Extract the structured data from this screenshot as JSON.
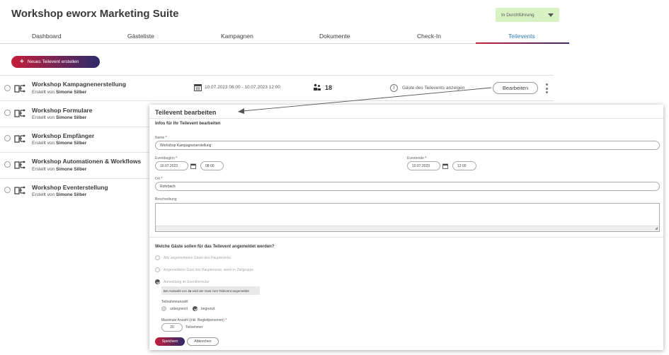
{
  "app": {
    "title": "Workshop eworx Marketing Suite"
  },
  "status_dropdown": {
    "value": "In Durchführung"
  },
  "tabs": [
    {
      "label": "Dashboard"
    },
    {
      "label": "Gästeliste"
    },
    {
      "label": "Kampagnen"
    },
    {
      "label": "Dokumente"
    },
    {
      "label": "Check-In"
    },
    {
      "label": "Teilevents"
    }
  ],
  "active_tab": "Teilevents",
  "new_button": {
    "label": "Neues Teilevent erstellen"
  },
  "events": [
    {
      "title": "Workshop Kampagnenerstellung",
      "created_prefix": "Erstellt von",
      "author": "Simone Silber"
    },
    {
      "title": "Workshop Formulare",
      "created_prefix": "Erstellt von",
      "author": "Simone Silber"
    },
    {
      "title": "Workshop Empfänger",
      "created_prefix": "Erstellt von",
      "author": "Simone Silber"
    },
    {
      "title": "Workshop Automationen & Workflows",
      "created_prefix": "Erstellt von",
      "author": "Simone Silber"
    },
    {
      "title": "Workshop Eventerstellung",
      "created_prefix": "Erstellt von",
      "author": "Simone Silber"
    }
  ],
  "first_row": {
    "date_range": "10.07.2023 08:00 - 10.07.2023 12:00",
    "guest_count": "18",
    "guests_link": "Gäste des Teilevents anzeigen",
    "info_glyph": "i",
    "edit_label": "Bearbeiten"
  },
  "modal": {
    "title": "Teilevent bearbeiten",
    "subtitle": "Infos für Ihr Teilevent bearbeiten",
    "name_label": "Name",
    "name_value": "Workshop Kampagnenerstellung",
    "start_label": "Eventbeginn",
    "start_date": "10.07.2023",
    "start_time": "08:00",
    "end_label": "Eventende",
    "end_date": "10.07.2023",
    "end_time": "12:00",
    "location_label": "Ort",
    "location_value": "Rohrbach",
    "description_label": "Beschreibung",
    "required_mark": "*",
    "question": "Welche Gäste sollen für das Teilevent angemeldet werden?",
    "options": [
      "Alle angemeldeten Gäste des Hauptevents",
      "Angemeldeter Gast des Hauptevents, wenn in Zielgruppe",
      "Anmeldung im Eventformular"
    ],
    "hint_prefix": "Bei Auswahl von",
    "hint_bold": "Ja",
    "hint_suffix": "wird der Gast zum Teilevent angemeldet",
    "participants_label": "Teilnahmeanzahl",
    "unlimited_label": "unbegrenzt",
    "limited_label": "begrenzt",
    "max_label": "Maximale Anzahl (inkl. Begleitpersonen)",
    "max_value": "20",
    "max_unit": "Teilnehmer",
    "save_label": "Speichern",
    "cancel_label": "Abbrechen"
  },
  "colors": {
    "accent_red": "#c41e3a",
    "accent_navy": "#2d2a6a",
    "active_tab": "#2f7fbf",
    "status_bg": "#d8f2c4"
  },
  "icons": [
    "calendar-icon",
    "people-icon",
    "info-icon",
    "sub-event-icon",
    "plus-icon",
    "kebab-menu-icon",
    "chevron-down-icon"
  ]
}
